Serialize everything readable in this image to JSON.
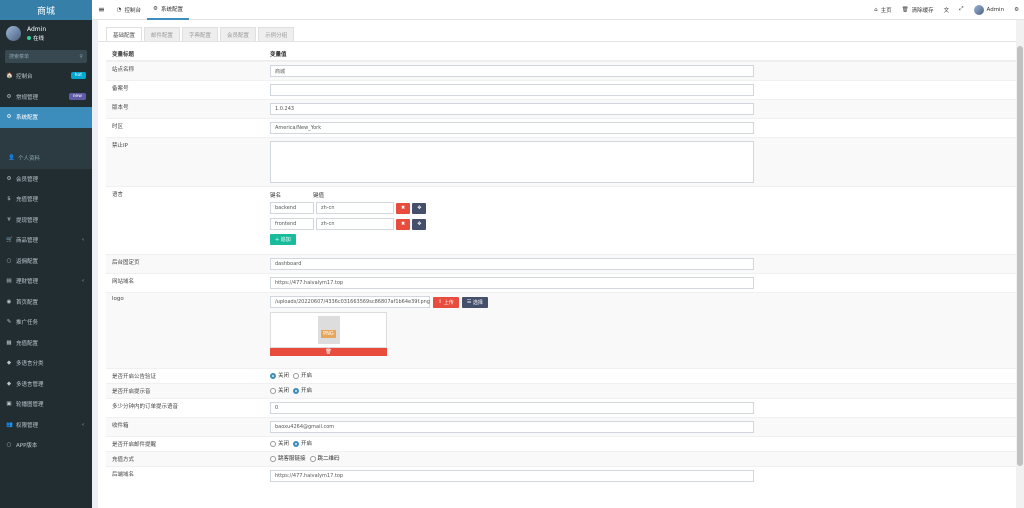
{
  "app": {
    "title": "商城"
  },
  "user": {
    "name": "Admin",
    "status": "在线"
  },
  "search": {
    "placeholder": "搜索菜单"
  },
  "menu": [
    {
      "name": "dashboard",
      "icon": "🏠",
      "label": "控制台",
      "badge": "hot",
      "badge_color": "#00a7d0"
    },
    {
      "name": "general",
      "icon": "⚙",
      "label": "常规管理",
      "badge": "new",
      "badge_color": "#605ca8"
    },
    {
      "name": "system-config",
      "icon": "⚙",
      "label": "系统配置",
      "active": true
    },
    {
      "name": "blank",
      "icon": "",
      "label": ""
    },
    {
      "name": "profile",
      "icon": "👤",
      "label": "个人资料",
      "dim": true
    },
    {
      "name": "members",
      "icon": "⚙",
      "label": "会员管理"
    },
    {
      "name": "recharge",
      "icon": "$",
      "label": "充值管理"
    },
    {
      "name": "withdraw",
      "icon": "¥",
      "label": "提现管理"
    },
    {
      "name": "goods",
      "icon": "🛒",
      "label": "商品管理",
      "arrow": true
    },
    {
      "name": "rebate",
      "icon": "○",
      "label": "返佣配置"
    },
    {
      "name": "finance",
      "icon": "▤",
      "label": "理财管理",
      "arrow": true
    },
    {
      "name": "home-config",
      "icon": "◉",
      "label": "首页配置"
    },
    {
      "name": "promo",
      "icon": "✎",
      "label": "推广任务"
    },
    {
      "name": "payment",
      "icon": "▦",
      "label": "充值配置"
    },
    {
      "name": "multilang-cat",
      "icon": "◆",
      "label": "多语言分类"
    },
    {
      "name": "multilang",
      "icon": "◆",
      "label": "多语言管理"
    },
    {
      "name": "carousel",
      "icon": "▣",
      "label": "轮播图管理"
    },
    {
      "name": "permissions",
      "icon": "👥",
      "label": "权限管理",
      "arrow": true
    },
    {
      "name": "app-version",
      "icon": "○",
      "label": "APP版本"
    }
  ],
  "topbar": {
    "menu_icon": "≡",
    "dashboard": "控制台",
    "sysconfig": "系统配置",
    "home": "主页",
    "clear_cache": "清除缓存",
    "admin": "Admin"
  },
  "tabs": [
    "基础配置",
    "邮件配置",
    "字典配置",
    "会员配置",
    "示例分组"
  ],
  "table": {
    "col_title": "变量标题",
    "col_value": "变量值"
  },
  "rows": {
    "site_name": {
      "label": "站点名称",
      "value": "商城"
    },
    "beian": {
      "label": "备案号",
      "value": ""
    },
    "version": {
      "label": "版本号",
      "value": "1.0.243"
    },
    "timezone": {
      "label": "时区",
      "value": "America/New_York"
    },
    "forbid_ip": {
      "label": "禁止IP",
      "value": ""
    },
    "language": {
      "label": "语言",
      "key_header": "键名",
      "val_header": "键值",
      "items": [
        {
          "key": "backend",
          "val": "zh-cn"
        },
        {
          "key": "frontend",
          "val": "zh-cn"
        }
      ],
      "add_label": "+ 追加"
    },
    "fixedpage": {
      "label": "后台固定页",
      "value": "dashboard"
    },
    "domain": {
      "label": "网站域名",
      "value": "https://477.haivalym17.top"
    },
    "logo": {
      "label": "logo",
      "value": "/uploads/20220607/4336c031663569sc86807af1b64e39f.png",
      "upload": "上传",
      "choose": "选择",
      "png": "PNG"
    },
    "open_verify": {
      "label": "是否开启公告验证",
      "opt1": "关闭",
      "opt2": "开启",
      "sel": 1
    },
    "open_tip": {
      "label": "是否开启提示音",
      "opt1": "关闭",
      "opt2": "开启",
      "sel": 2
    },
    "tip_minutes": {
      "label": "多少分钟内的订单提示语音",
      "value": "0"
    },
    "email": {
      "label": "收件箱",
      "value": "baoxu4264@gmail.com"
    },
    "open_email": {
      "label": "是否开启邮件提醒",
      "opt1": "关闭",
      "opt2": "开启",
      "sel": 2
    },
    "pay_mode": {
      "label": "充值方式",
      "opt1": "跳客服链接",
      "opt2": "跳二维码",
      "sel": 0
    },
    "api_domain": {
      "label": "后端域名",
      "value": "https://477.haivalym17.top"
    }
  }
}
